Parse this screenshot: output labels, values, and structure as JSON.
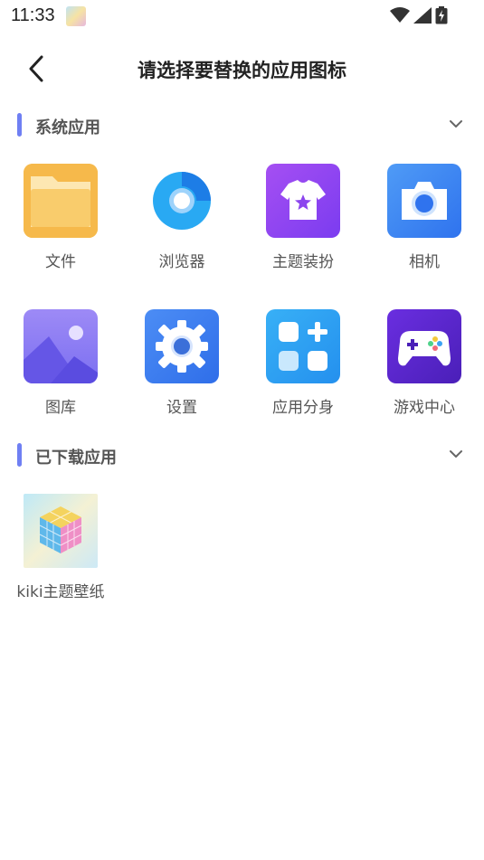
{
  "status_bar": {
    "time": "11:33",
    "icons": [
      "wifi-icon",
      "signal-icon",
      "battery-charging-icon"
    ]
  },
  "header": {
    "back_icon": "chevron-left-icon",
    "title": "请选择要替换的应用图标"
  },
  "sections": {
    "system": {
      "title": "系统应用",
      "toggle_icon": "chevron-down-icon",
      "apps": [
        {
          "label": "文件",
          "icon": "folder-icon"
        },
        {
          "label": "浏览器",
          "icon": "browser-icon"
        },
        {
          "label": "主题装扮",
          "icon": "tshirt-icon"
        },
        {
          "label": "相机",
          "icon": "camera-icon"
        },
        {
          "label": "图库",
          "icon": "gallery-icon"
        },
        {
          "label": "设置",
          "icon": "gear-icon"
        },
        {
          "label": "应用分身",
          "icon": "app-clone-icon"
        },
        {
          "label": "游戏中心",
          "icon": "gamepad-icon"
        }
      ]
    },
    "downloaded": {
      "title": "已下载应用",
      "toggle_icon": "chevron-down-icon",
      "apps": [
        {
          "label": "kiki主题壁纸",
          "icon": "rubik-cube-icon"
        }
      ]
    }
  },
  "colors": {
    "accent": "#6f7ff3",
    "folder": "#f7c45c",
    "browser": "#2aa2f4",
    "theme": "#8a45f0",
    "camera": "#3f86f2",
    "gallery": "#8a76f4",
    "settings": "#3c74ee",
    "clone": "#2da3f3",
    "game": "#5a2ad6"
  }
}
